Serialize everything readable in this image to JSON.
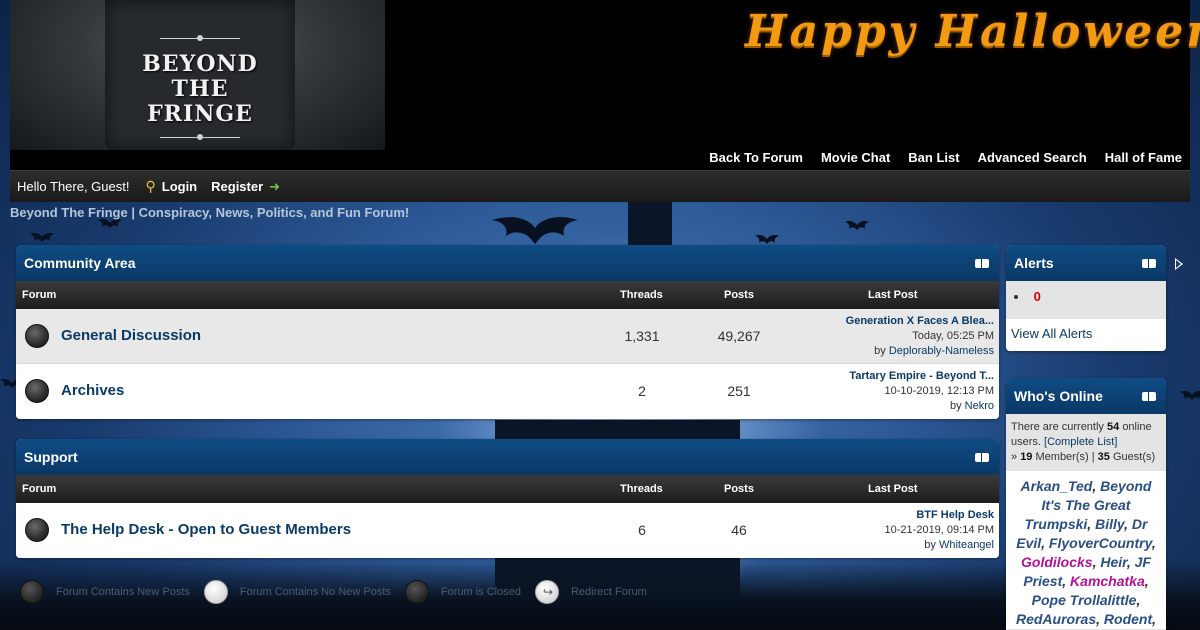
{
  "header": {
    "logo_lines": [
      "BEYOND",
      "THE",
      "FRINGE"
    ],
    "banner_text": "Happy Halloween!",
    "nav_links": [
      "Back To Forum",
      "Movie Chat",
      "Ban List",
      "Advanced Search",
      "Hall of Fame"
    ]
  },
  "userbar": {
    "greeting": "Hello There, Guest!",
    "login_label": "Login",
    "register_label": "Register"
  },
  "board_title": "Beyond The Fringe | Conspiracy, News, Politics, and Fun Forum!",
  "columns": {
    "forum": "Forum",
    "threads": "Threads",
    "posts": "Posts",
    "last_post": "Last Post"
  },
  "categories": [
    {
      "title": "Community Area",
      "forums": [
        {
          "name": "General Discussion",
          "threads": "1,331",
          "posts": "49,267",
          "last_title": "Generation X Faces A Blea...",
          "last_time": "Today, 05:25 PM",
          "last_by": "by",
          "last_user": "Deplorably-Nameless"
        },
        {
          "name": "Archives",
          "threads": "2",
          "posts": "251",
          "last_title": "Tartary Empire - Beyond T...",
          "last_time": "10-10-2019, 12:13 PM",
          "last_by": "by",
          "last_user": "Nekro"
        }
      ]
    },
    {
      "title": "Support",
      "forums": [
        {
          "name": "The Help Desk - Open to Guest Members",
          "threads": "6",
          "posts": "46",
          "last_title": "BTF Help Desk",
          "last_time": "10-21-2019, 09:14 PM",
          "last_by": "by",
          "last_user": "Whiteangel"
        }
      ]
    }
  ],
  "legend": {
    "new_posts": "Forum Contains New Posts",
    "no_new_posts": "Forum Contains No New Posts",
    "closed": "Forum is Closed",
    "redirect": "Redirect Forum"
  },
  "sidebar": {
    "alerts": {
      "title": "Alerts",
      "count": "0",
      "view_all": "View All Alerts"
    },
    "whos_online": {
      "title": "Who's Online",
      "text_prefix": "There are currently",
      "online_count": "54",
      "text_suffix": "online users.",
      "complete_list": "[Complete List]",
      "members_prefix": "»",
      "members_count": "19",
      "members_label": "Member(s) |",
      "guests_count": "35",
      "guests_label": "Guest(s)",
      "users": [
        {
          "name": "Arkan_Ted",
          "sep": ", "
        },
        {
          "name": "Beyond It's The Great Trumpski",
          "sep": ", "
        },
        {
          "name": "Billy",
          "sep": ", "
        },
        {
          "name": "Dr Evil",
          "sep": ", "
        },
        {
          "name": "FlyoverCountry",
          "sep": ", "
        },
        {
          "name": "Goldilocks",
          "sep": ", ",
          "mod": true
        },
        {
          "name": "Heir",
          "sep": ", "
        },
        {
          "name": "JF Priest",
          "sep": ", "
        },
        {
          "name": "Kamchatka",
          "sep": ", ",
          "mod": true
        },
        {
          "name": "Pope Trollalittle",
          "sep": ", "
        },
        {
          "name": "RedAuroras",
          "sep": ", "
        },
        {
          "name": "Rodent",
          "sep": ","
        }
      ]
    }
  },
  "colors": {
    "header_blue": "#0a3866",
    "link_blue": "#0b3a66",
    "banner_orange": "#f29a12",
    "alert_red": "#d40000",
    "moderator_magenta": "#b4119a"
  }
}
